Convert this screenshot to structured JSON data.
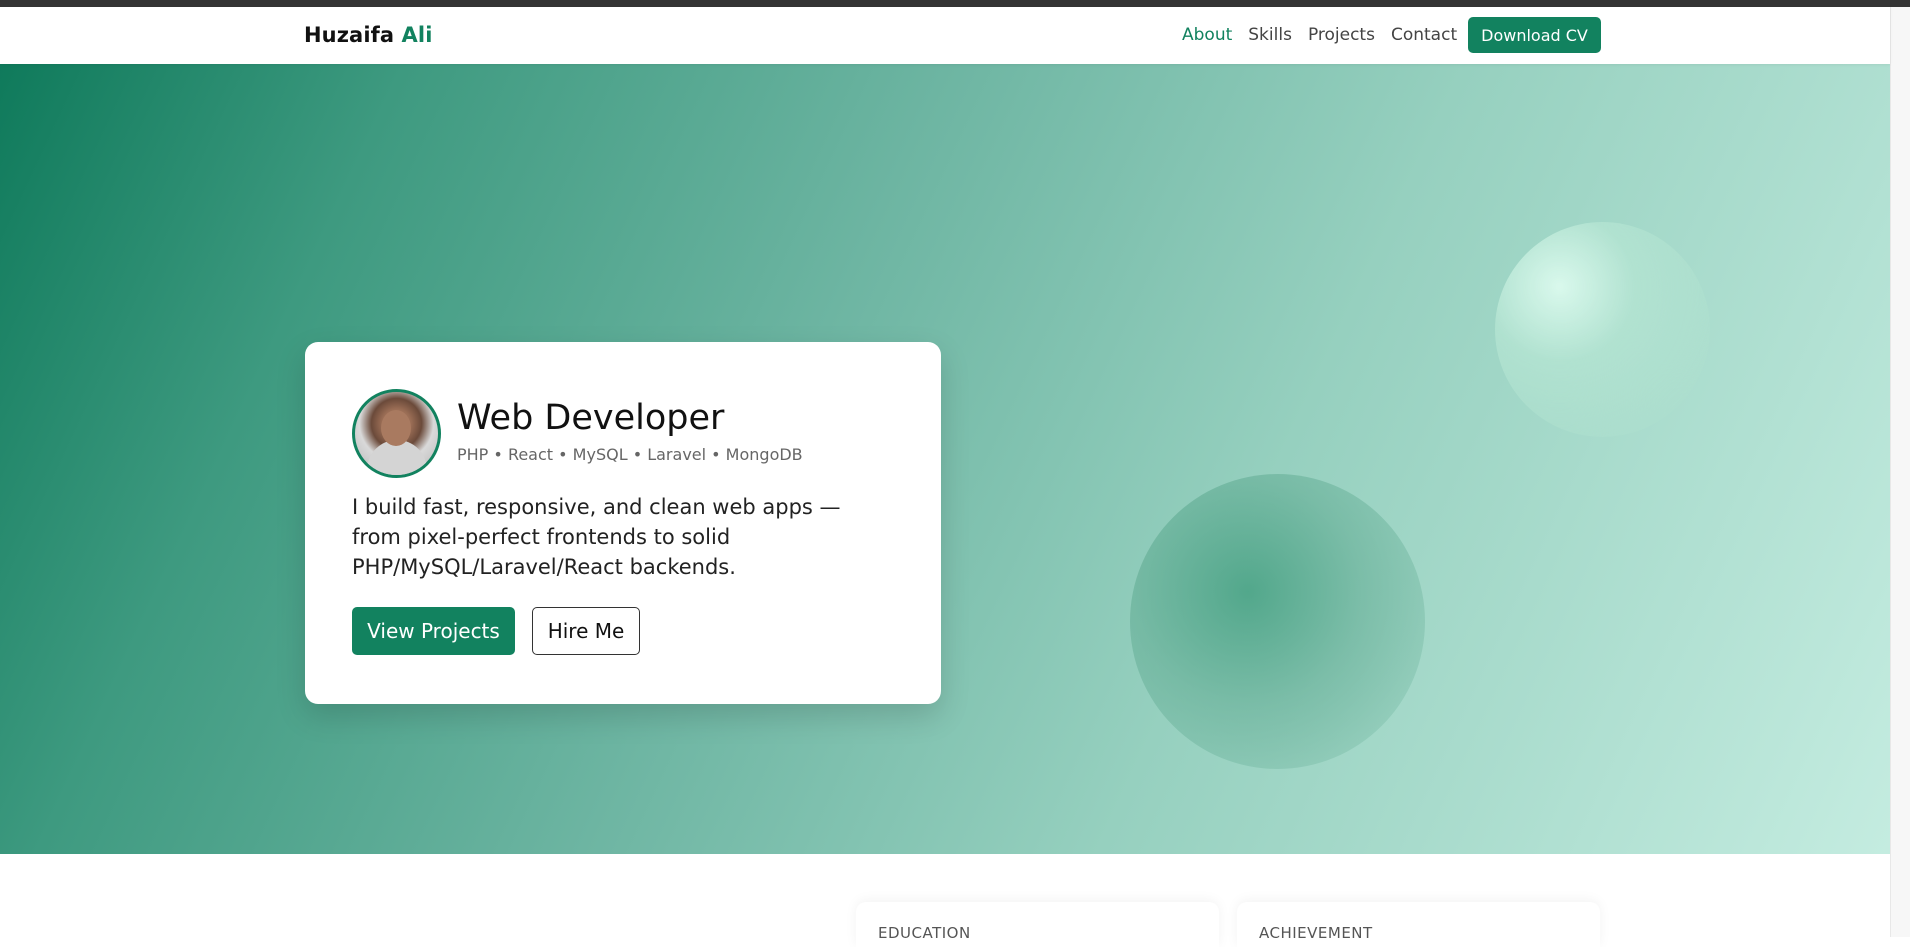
{
  "brand": {
    "first": "Huzaifa",
    "last": "Ali"
  },
  "nav": {
    "items": [
      "About",
      "Skills",
      "Projects",
      "Contact"
    ],
    "active": "About",
    "download_label": "Download CV"
  },
  "hero": {
    "title": "Web Developer",
    "skills": "PHP • React • MySQL • Laravel • MongoDB",
    "bio": "I build fast, responsive, and clean web apps — from pixel-perfect frontends to solid PHP/MySQL/Laravel/React backends.",
    "primary_button": "View Projects",
    "secondary_button": "Hire Me"
  },
  "sections": {
    "education_label": "EDUCATION",
    "achievement_label": "ACHIEVEMENT"
  },
  "colors": {
    "accent": "#12825f",
    "hero_start": "#0f7a5b",
    "hero_end": "#c4ece0"
  }
}
